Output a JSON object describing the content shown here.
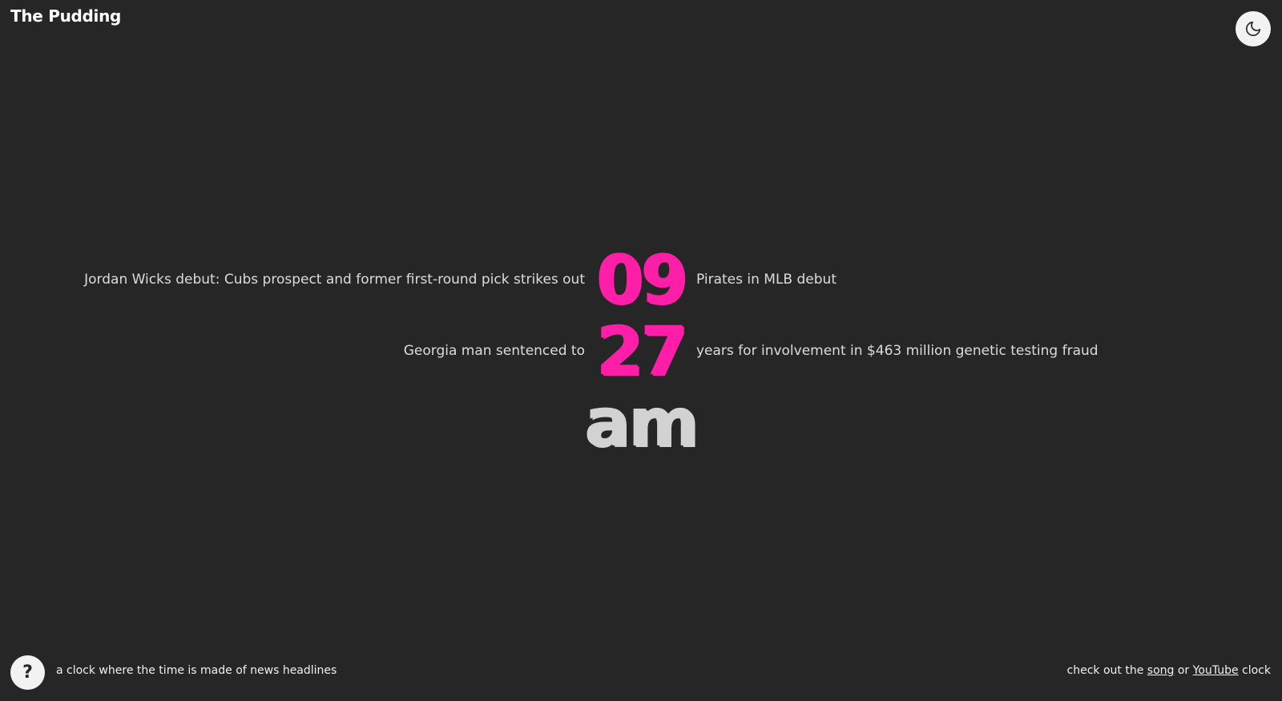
{
  "brand": {
    "logo_text": "The Pudding"
  },
  "theme_toggle": {
    "icon": "moon-icon"
  },
  "clock": {
    "hours": {
      "value": "09",
      "headline_before": "Jordan Wicks debut: Cubs prospect and former first-round pick strikes out",
      "headline_after": "Pirates in MLB debut"
    },
    "minutes": {
      "value": "27",
      "headline_before": "Georgia man sentenced to",
      "headline_after": "years for involvement in $463 million genetic testing fraud"
    },
    "meridiem": "am"
  },
  "footer": {
    "help_label": "?",
    "tagline": "a clock where the time is made of news headlines",
    "right_prefix": "check out the",
    "song_link": "song",
    "or_text": "or",
    "youtube_link": "YouTube",
    "right_suffix": "clock"
  },
  "colors": {
    "background": "#262626",
    "accent": "#ff1ea8",
    "text": "#dcdcdc"
  }
}
